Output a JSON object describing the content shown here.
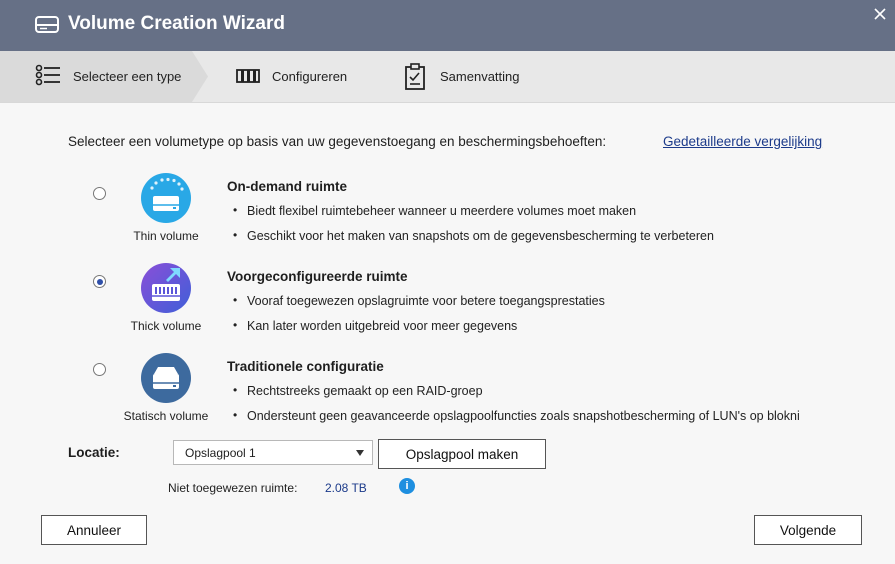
{
  "window": {
    "title": "Volume Creation Wizard"
  },
  "steps": [
    {
      "label": "Selecteer een type",
      "icon": "list-icon"
    },
    {
      "label": "Configureren",
      "icon": "configure-icon"
    },
    {
      "label": "Samenvatting",
      "icon": "clipboard-icon"
    }
  ],
  "prompt": "Selecteer een volumetype op basis van uw gegevenstoegang en beschermingsbehoeften:",
  "comparison_link": "Gedetailleerde vergelijking",
  "options": [
    {
      "volume_label": "Thin volume",
      "title": "On-demand ruimte",
      "bullets": [
        "Biedt flexibel ruimtebeheer wanneer u meerdere volumes moet maken",
        "Geschikt voor het maken van snapshots om de gegevensbescherming te verbeteren"
      ],
      "selected": false,
      "icon_color": "#29a8e6"
    },
    {
      "volume_label": "Thick volume",
      "title": "Voorgeconfigureerde ruimte",
      "bullets": [
        "Vooraf toegewezen opslagruimte voor betere toegangsprestaties",
        "Kan later worden uitgebreid voor meer gegevens"
      ],
      "selected": true,
      "icon_color": "#6a4fd0"
    },
    {
      "volume_label": "Statisch volume",
      "title": "Traditionele configuratie",
      "bullets": [
        "Rechtstreeks gemaakt op een RAID-groep",
        "Ondersteunt geen geavanceerde opslagpoolfuncties zoals snapshotbescherming of LUN's op blokni"
      ],
      "selected": false,
      "icon_color": "#3d6a9e"
    }
  ],
  "location": {
    "label": "Locatie:",
    "selected_pool": "Opslagpool 1",
    "create_pool_button": "Opslagpool maken",
    "unallocated_label": "Niet toegewezen ruimte:",
    "unallocated_value": "2.08 TB"
  },
  "footer": {
    "cancel": "Annuleer",
    "next": "Volgende"
  },
  "colors": {
    "titlebar": "#667086",
    "accent": "#2f4fa8",
    "link": "#1b3a8a"
  }
}
